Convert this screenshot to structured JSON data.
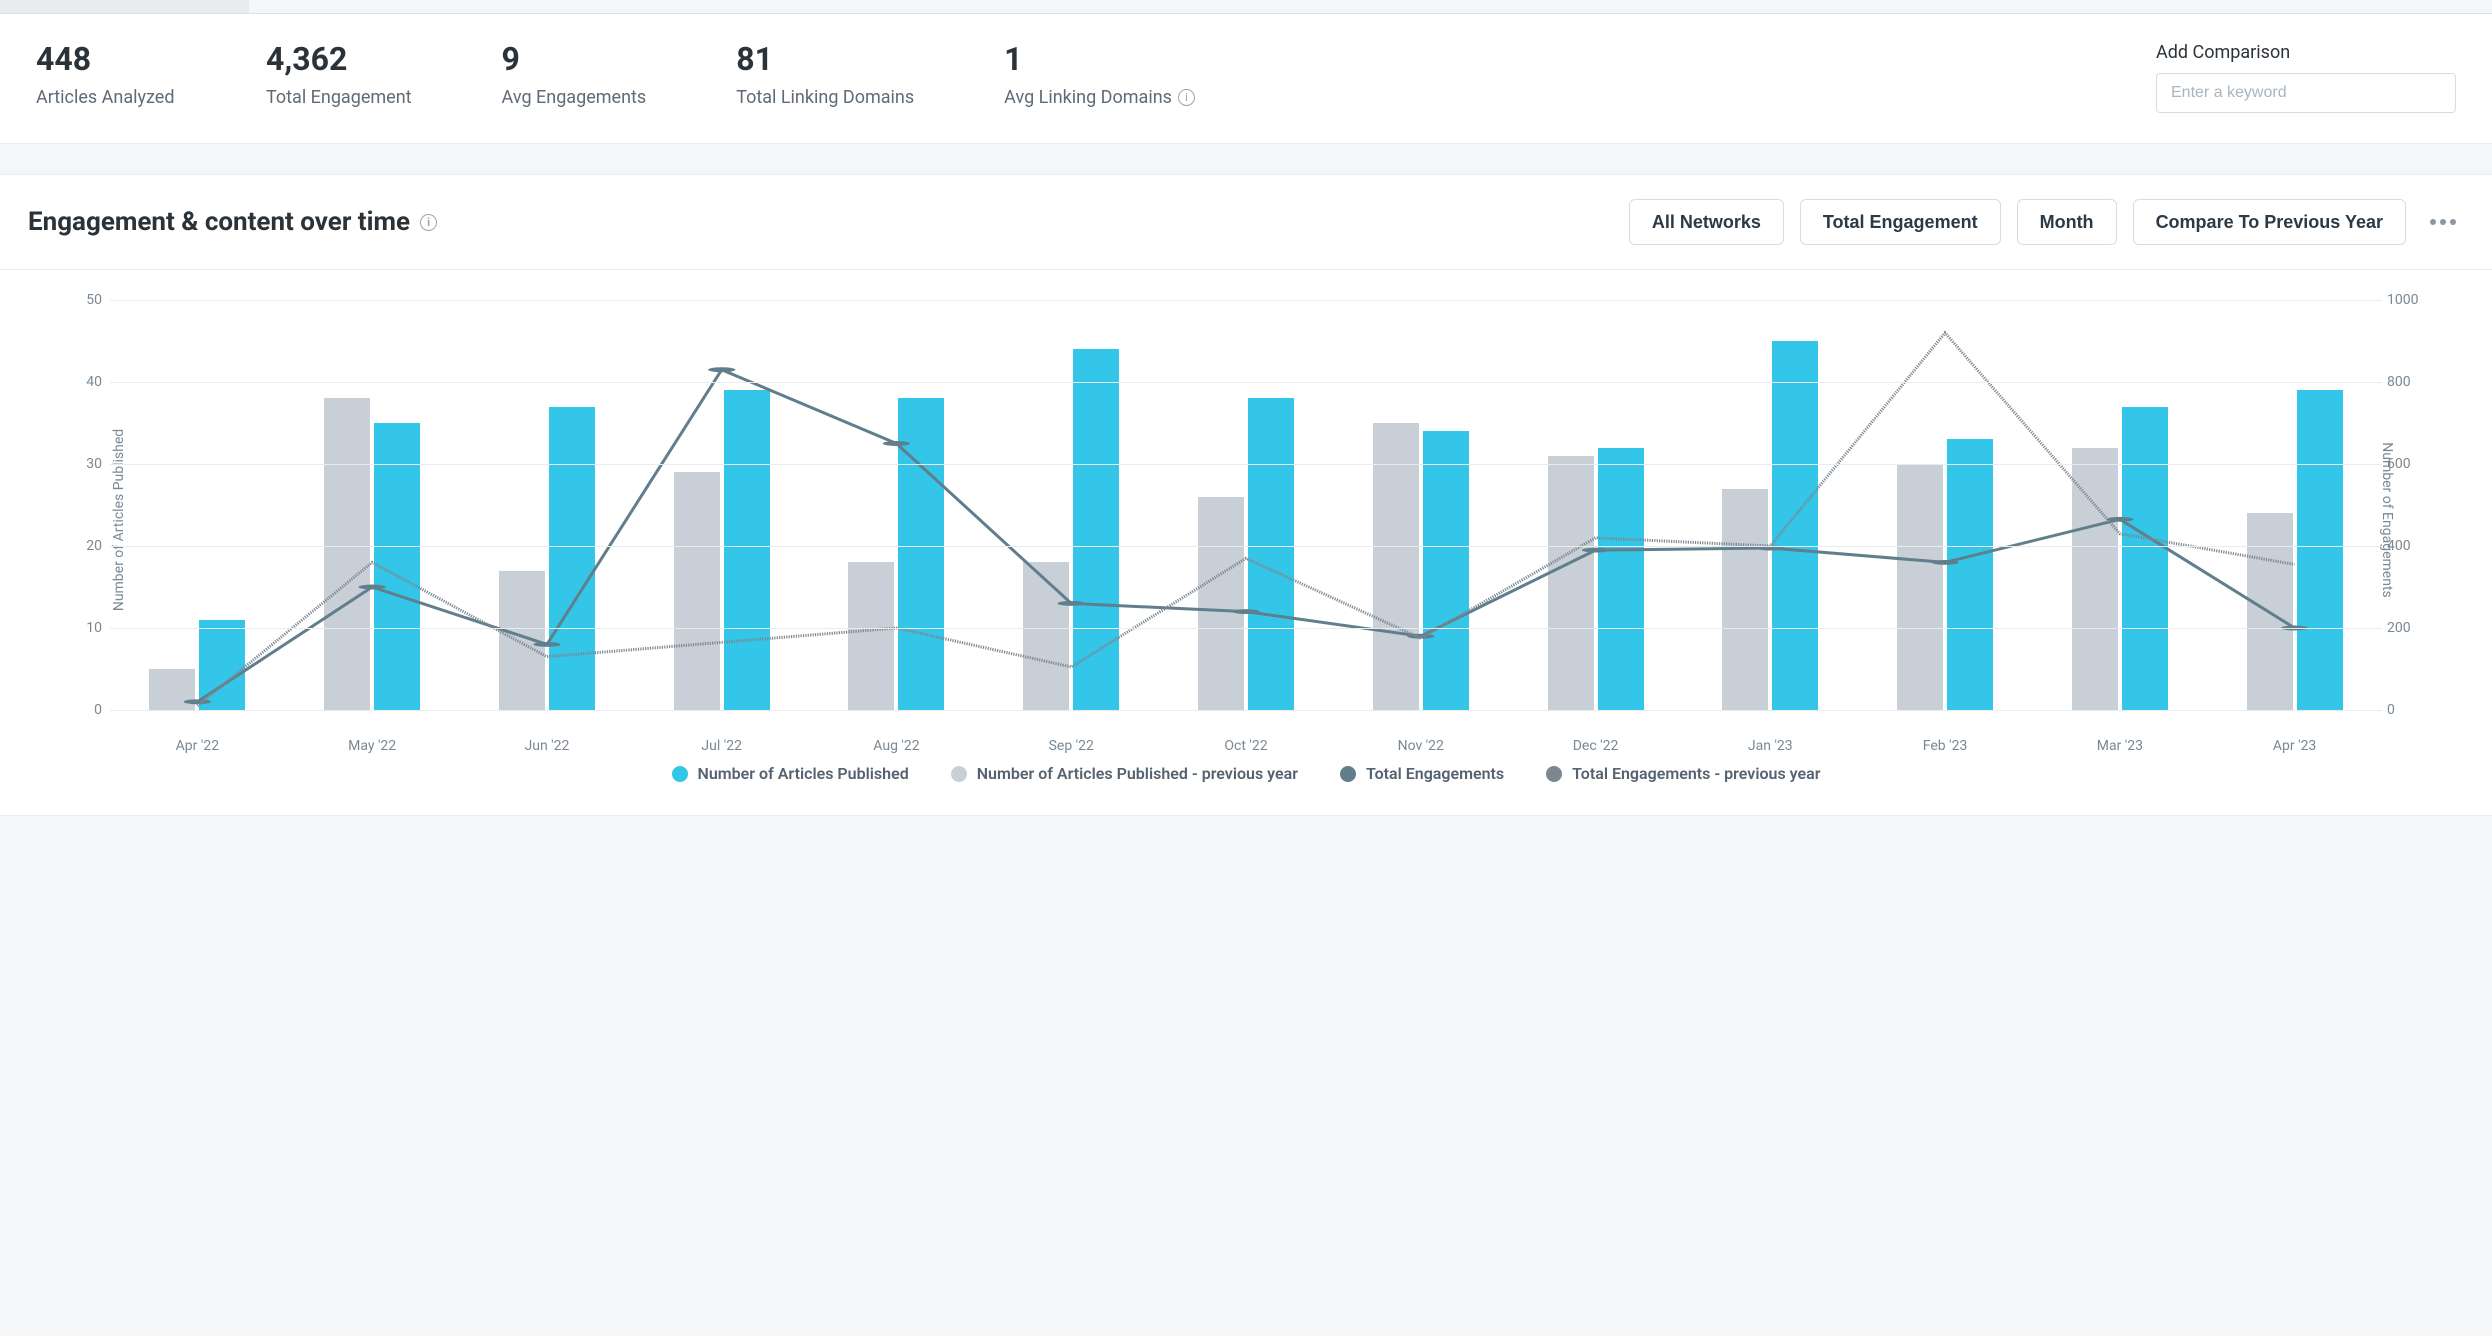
{
  "stats": [
    {
      "value": "448",
      "label": "Articles Analyzed",
      "info": false
    },
    {
      "value": "4,362",
      "label": "Total Engagement",
      "info": false
    },
    {
      "value": "9",
      "label": "Avg Engagements",
      "info": false
    },
    {
      "value": "81",
      "label": "Total Linking Domains",
      "info": false
    },
    {
      "value": "1",
      "label": "Avg Linking Domains",
      "info": true
    }
  ],
  "comparison": {
    "label": "Add Comparison",
    "placeholder": "Enter a keyword"
  },
  "chart": {
    "title": "Engagement & content over time",
    "controls": [
      "All Networks",
      "Total Engagement",
      "Month",
      "Compare To Previous Year"
    ]
  },
  "legend": [
    {
      "key": "articles_curr",
      "label": "Number of Articles Published",
      "color": "#33c6e8",
      "shape": "circle"
    },
    {
      "key": "articles_prev",
      "label": "Number of Articles Published - previous year",
      "color": "#c8cfd6",
      "shape": "circle"
    },
    {
      "key": "eng_curr",
      "label": "Total Engagements",
      "color": "#607e8c",
      "shape": "circle"
    },
    {
      "key": "eng_prev",
      "label": "Total Engagements - previous year",
      "color": "#7c8791",
      "shape": "circle"
    }
  ],
  "chart_data": {
    "type": "bar",
    "title": "Engagement & content over time",
    "xlabel": "",
    "ylabel_left": "Number of Articles Published",
    "ylabel_right": "Number of Engagements",
    "ylim_left": [
      0,
      50
    ],
    "ylim_right": [
      0,
      1000
    ],
    "yticks_left": [
      0,
      10,
      20,
      30,
      40,
      50
    ],
    "yticks_right": [
      0,
      200,
      400,
      600,
      800,
      1000
    ],
    "categories": [
      "Apr '22",
      "May '22",
      "Jun '22",
      "Jul '22",
      "Aug '22",
      "Sep '22",
      "Oct '22",
      "Nov '22",
      "Dec '22",
      "Jan '23",
      "Feb '23",
      "Mar '23",
      "Apr '23"
    ],
    "series": [
      {
        "name": "Number of Articles Published - previous year",
        "axis": "left",
        "kind": "bar",
        "color": "#c8cfd6",
        "values": [
          5,
          38,
          17,
          29,
          18,
          18,
          26,
          35,
          31,
          27,
          30,
          32,
          24
        ]
      },
      {
        "name": "Number of Articles Published",
        "axis": "left",
        "kind": "bar",
        "color": "#33c6e8",
        "values": [
          11,
          35,
          37,
          39,
          38,
          44,
          38,
          34,
          32,
          45,
          33,
          37,
          39
        ]
      },
      {
        "name": "Total Engagements",
        "axis": "right",
        "kind": "line",
        "color": "#607e8c",
        "dash": false,
        "values": [
          20,
          300,
          160,
          830,
          650,
          260,
          240,
          180,
          390,
          395,
          360,
          465,
          200
        ]
      },
      {
        "name": "Total Engagements - previous year",
        "axis": "right",
        "kind": "line",
        "color": "#7c8791",
        "dash": true,
        "values": [
          10,
          360,
          130,
          165,
          200,
          105,
          370,
          175,
          420,
          400,
          920,
          430,
          355
        ]
      }
    ]
  }
}
